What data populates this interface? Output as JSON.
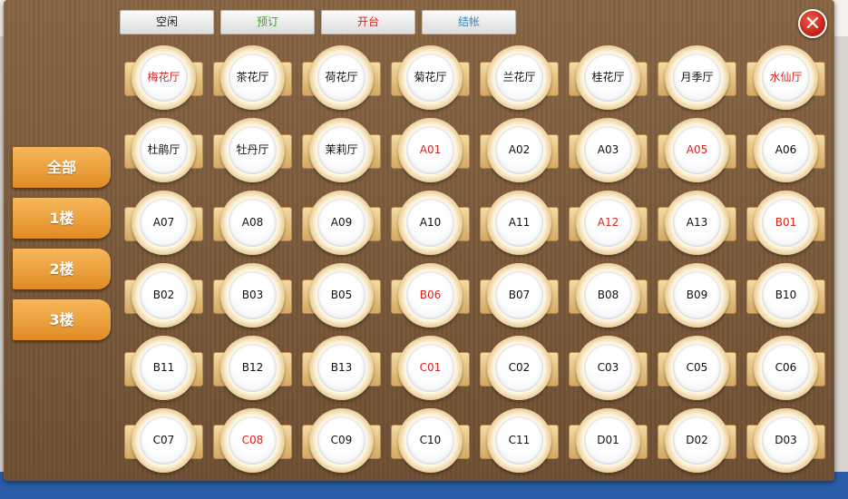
{
  "status_tabs": [
    {
      "label": "空闲",
      "color": "#1a1a1a"
    },
    {
      "label": "预订",
      "color": "#3da324"
    },
    {
      "label": "开台",
      "color": "#d8231f"
    },
    {
      "label": "结帐",
      "color": "#2a8ad0"
    }
  ],
  "close_button": {
    "glyph": "✕",
    "icon": "close-icon"
  },
  "floors": [
    {
      "label": "全部"
    },
    {
      "label": "1楼"
    },
    {
      "label": "2楼"
    },
    {
      "label": "3楼"
    }
  ],
  "tables": [
    {
      "name": "梅花厅",
      "status": "busy"
    },
    {
      "name": "茶花厅",
      "status": "free"
    },
    {
      "name": "荷花厅",
      "status": "free"
    },
    {
      "name": "菊花厅",
      "status": "free"
    },
    {
      "name": "兰花厅",
      "status": "free"
    },
    {
      "name": "桂花厅",
      "status": "free"
    },
    {
      "name": "月季厅",
      "status": "free"
    },
    {
      "name": "水仙厅",
      "status": "busy"
    },
    {
      "name": "杜鹃厅",
      "status": "free"
    },
    {
      "name": "牡丹厅",
      "status": "free"
    },
    {
      "name": "茉莉厅",
      "status": "free"
    },
    {
      "name": "A01",
      "status": "busy"
    },
    {
      "name": "A02",
      "status": "free"
    },
    {
      "name": "A03",
      "status": "free"
    },
    {
      "name": "A05",
      "status": "busy"
    },
    {
      "name": "A06",
      "status": "free"
    },
    {
      "name": "A07",
      "status": "free"
    },
    {
      "name": "A08",
      "status": "free"
    },
    {
      "name": "A09",
      "status": "free"
    },
    {
      "name": "A10",
      "status": "free"
    },
    {
      "name": "A11",
      "status": "free"
    },
    {
      "name": "A12",
      "status": "busy"
    },
    {
      "name": "A13",
      "status": "free"
    },
    {
      "name": "B01",
      "status": "busy"
    },
    {
      "name": "B02",
      "status": "free"
    },
    {
      "name": "B03",
      "status": "free"
    },
    {
      "name": "B05",
      "status": "free"
    },
    {
      "name": "B06",
      "status": "busy"
    },
    {
      "name": "B07",
      "status": "free"
    },
    {
      "name": "B08",
      "status": "free"
    },
    {
      "name": "B09",
      "status": "free"
    },
    {
      "name": "B10",
      "status": "free"
    },
    {
      "name": "B11",
      "status": "free"
    },
    {
      "name": "B12",
      "status": "free"
    },
    {
      "name": "B13",
      "status": "free"
    },
    {
      "name": "C01",
      "status": "busy"
    },
    {
      "name": "C02",
      "status": "free"
    },
    {
      "name": "C03",
      "status": "free"
    },
    {
      "name": "C05",
      "status": "free"
    },
    {
      "name": "C06",
      "status": "free"
    },
    {
      "name": "C07",
      "status": "free"
    },
    {
      "name": "C08",
      "status": "busy"
    },
    {
      "name": "C09",
      "status": "free"
    },
    {
      "name": "C10",
      "status": "free"
    },
    {
      "name": "C11",
      "status": "free"
    },
    {
      "name": "D01",
      "status": "free"
    },
    {
      "name": "D02",
      "status": "free"
    },
    {
      "name": "D03",
      "status": "free"
    }
  ]
}
